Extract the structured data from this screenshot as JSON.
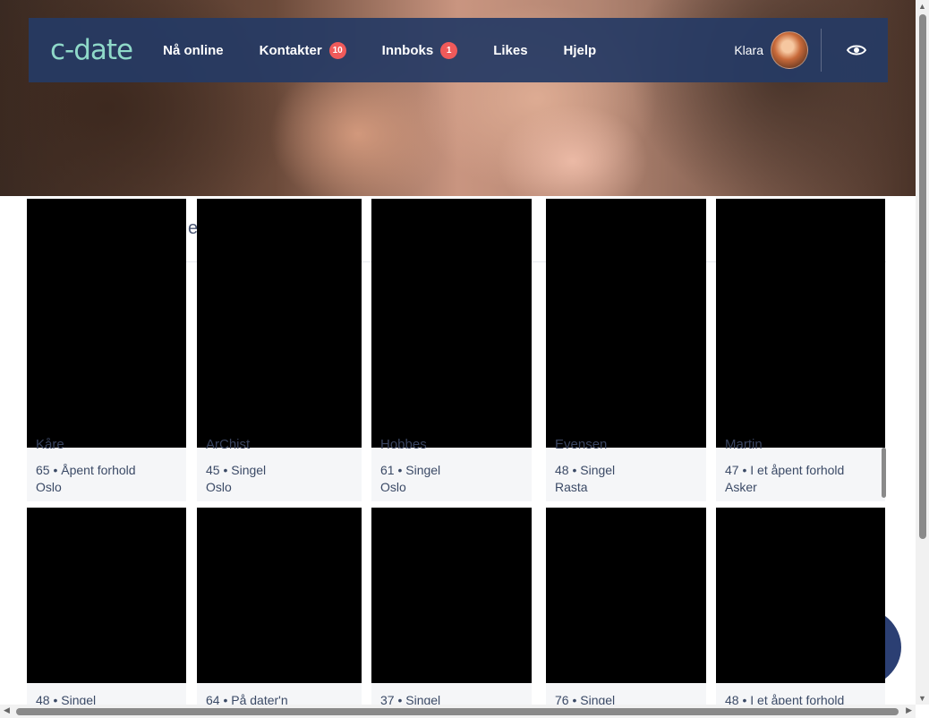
{
  "header": {
    "logo": "c-date",
    "nav": [
      {
        "label": "Nå online",
        "badge": null
      },
      {
        "label": "Kontakter",
        "badge": "10"
      },
      {
        "label": "Innboks",
        "badge": "1"
      },
      {
        "label": "Likes",
        "badge": null
      },
      {
        "label": "Hjelp",
        "badge": null
      }
    ],
    "user_name": "Klara"
  },
  "section": {
    "title_fragment": "e?"
  },
  "profiles_row1": [
    {
      "name": "Kåre",
      "info": "65 • Åpent forhold",
      "city": "Oslo"
    },
    {
      "name": "ArChist",
      "info": "45 • Singel",
      "city": "Oslo"
    },
    {
      "name": "Hobbes",
      "info": "61 • Singel",
      "city": "Oslo"
    },
    {
      "name": "Evensen",
      "info": "48 • Singel",
      "city": "Rasta"
    },
    {
      "name": "Martin",
      "info": "47 • I et åpent forhold",
      "city": "Asker"
    }
  ],
  "profiles_row2": [
    {
      "info": "48 • Singel"
    },
    {
      "info": "64 • På dater'n"
    },
    {
      "info": "37 • Singel"
    },
    {
      "info": "76 • Singel"
    },
    {
      "info": "48 • I et åpent forhold"
    }
  ]
}
